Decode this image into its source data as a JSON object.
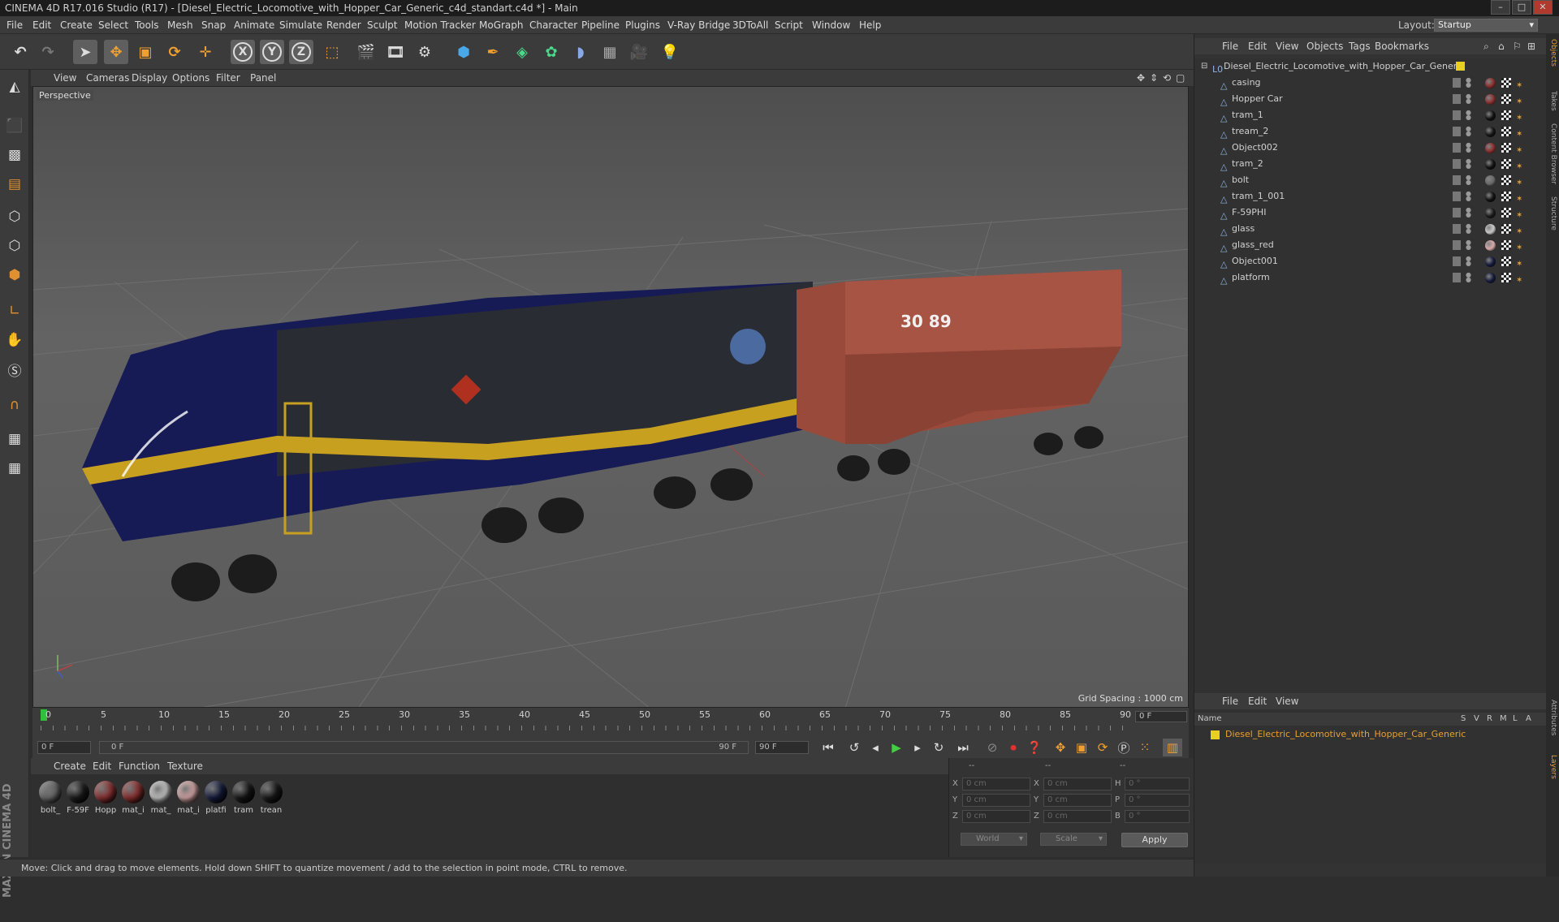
{
  "window": {
    "title": "CINEMA 4D R17.016 Studio (R17) - [Diesel_Electric_Locomotive_with_Hopper_Car_Generic_c4d_standart.c4d *] - Main"
  },
  "menubar": {
    "items": [
      "File",
      "Edit",
      "Create",
      "Select",
      "Tools",
      "Mesh",
      "Snap",
      "Animate",
      "Simulate",
      "Render",
      "Sculpt",
      "Motion Tracker",
      "MoGraph",
      "Character",
      "Pipeline",
      "Plugins",
      "V-Ray Bridge",
      "3DToAll",
      "Script",
      "Window",
      "Help"
    ],
    "layout_label": "Layout:",
    "layout_value": "Startup"
  },
  "viewport": {
    "menu": [
      "View",
      "Cameras",
      "Display",
      "Options",
      "Filter",
      "Panel"
    ],
    "label": "Perspective",
    "grid_spacing": "Grid Spacing : 1000 cm",
    "hopper_number": "30 89"
  },
  "timeline": {
    "ticks": [
      "0",
      "5",
      "10",
      "15",
      "20",
      "25",
      "30",
      "35",
      "40",
      "45",
      "50",
      "55",
      "60",
      "65",
      "70",
      "75",
      "80",
      "85",
      "90"
    ],
    "current_frame": "0 F",
    "start_field": "0 F",
    "range_start": "0 F",
    "range_end": "90 F",
    "end_field": "90 F"
  },
  "materials": {
    "menu": [
      "Create",
      "Edit",
      "Function",
      "Texture"
    ],
    "items": [
      {
        "label": "bolt_",
        "color": "#6a6a6a"
      },
      {
        "label": "F-59F",
        "color": "#1a1a1a"
      },
      {
        "label": "Hopp",
        "color": "#8a3030"
      },
      {
        "label": "mat_i",
        "color": "#8a2e2e"
      },
      {
        "label": "mat_",
        "color": "#c8c8c8"
      },
      {
        "label": "mat_i",
        "color": "#d8a8a8"
      },
      {
        "label": "platfi",
        "color": "#141a3a"
      },
      {
        "label": "tram",
        "color": "#151515"
      },
      {
        "label": "trean",
        "color": "#181818"
      }
    ]
  },
  "coordinates": {
    "header": [
      "--",
      "--",
      "--"
    ],
    "rows": [
      {
        "a": "X",
        "av": "0 cm",
        "b": "X",
        "bv": "0 cm",
        "c": "H",
        "cv": "0 °"
      },
      {
        "a": "Y",
        "av": "0 cm",
        "b": "Y",
        "bv": "0 cm",
        "c": "P",
        "cv": "0 °"
      },
      {
        "a": "Z",
        "av": "0 cm",
        "b": "Z",
        "bv": "0 cm",
        "c": "B",
        "cv": "0 °"
      }
    ],
    "world": "World",
    "scale": "Scale",
    "apply": "Apply"
  },
  "status": {
    "text": "Move: Click and drag to move elements. Hold down SHIFT to quantize movement / add to the selection in point mode, CTRL to remove."
  },
  "objects": {
    "menu": [
      "File",
      "Edit",
      "View",
      "Objects",
      "Tags",
      "Bookmarks"
    ],
    "root": "Diesel_Electric_Locomotive_with_Hopper_Car_Generic",
    "children": [
      {
        "name": "casing",
        "tag": "#8a2e2e"
      },
      {
        "name": "Hopper Car",
        "tag": "#8a3030"
      },
      {
        "name": "tram_1",
        "tag": "#111111"
      },
      {
        "name": "tream_2",
        "tag": "#141414"
      },
      {
        "name": "Object002",
        "tag": "#8a2e2e"
      },
      {
        "name": "tram_2",
        "tag": "#111111"
      },
      {
        "name": "bolt",
        "tag": "#6a6a6a"
      },
      {
        "name": "tram_1_001",
        "tag": "#111111"
      },
      {
        "name": "F-59PHI",
        "tag": "#1a1a1a"
      },
      {
        "name": "glass",
        "tag": "#c8c8c8"
      },
      {
        "name": "glass_red",
        "tag": "#d8a8a8"
      },
      {
        "name": "Object001",
        "tag": "#141a3a"
      },
      {
        "name": "platform",
        "tag": "#141a3a"
      }
    ]
  },
  "layers": {
    "menu": [
      "File",
      "Edit",
      "View"
    ],
    "name_header": "Name",
    "cols": [
      "S",
      "V",
      "R",
      "M",
      "L",
      "A"
    ],
    "item": "Diesel_Electric_Locomotive_with_Hopper_Car_Generic"
  },
  "side_tabs": [
    "Objects",
    "Takes",
    "Content Browser",
    "Structure",
    "Attributes",
    "Layers"
  ]
}
